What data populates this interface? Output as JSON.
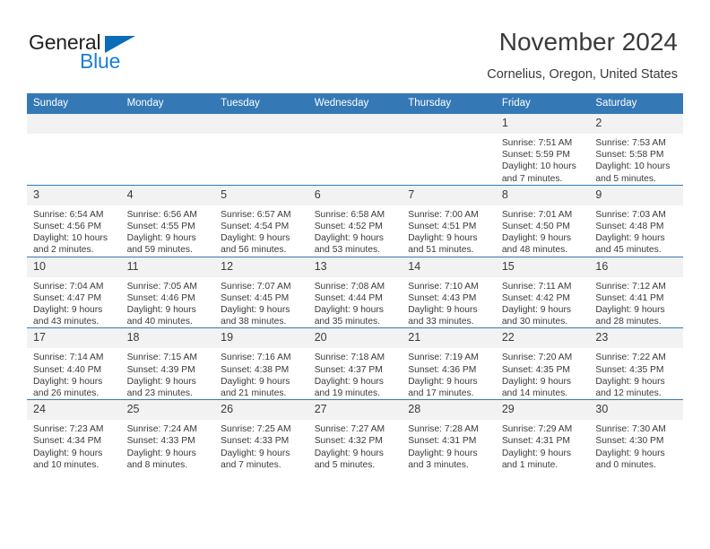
{
  "logo": {
    "word_one": "General",
    "word_two": "Blue",
    "triangle_icon": "triangle-icon",
    "color_dark": "#231f20",
    "color_blue": "#1b7fd4"
  },
  "header": {
    "title": "November 2024",
    "subtitle": "Cornelius, Oregon, United States",
    "accent_color": "#3479b5"
  },
  "calendar": {
    "weekday_headers": [
      "Sunday",
      "Monday",
      "Tuesday",
      "Wednesday",
      "Thursday",
      "Friday",
      "Saturday"
    ],
    "weeks": [
      [
        {
          "day": "",
          "sunrise": "",
          "sunset": "",
          "daylight_a": "",
          "daylight_b": ""
        },
        {
          "day": "",
          "sunrise": "",
          "sunset": "",
          "daylight_a": "",
          "daylight_b": ""
        },
        {
          "day": "",
          "sunrise": "",
          "sunset": "",
          "daylight_a": "",
          "daylight_b": ""
        },
        {
          "day": "",
          "sunrise": "",
          "sunset": "",
          "daylight_a": "",
          "daylight_b": ""
        },
        {
          "day": "",
          "sunrise": "",
          "sunset": "",
          "daylight_a": "",
          "daylight_b": ""
        },
        {
          "day": "1",
          "sunrise": "Sunrise: 7:51 AM",
          "sunset": "Sunset: 5:59 PM",
          "daylight_a": "Daylight: 10 hours",
          "daylight_b": "and 7 minutes."
        },
        {
          "day": "2",
          "sunrise": "Sunrise: 7:53 AM",
          "sunset": "Sunset: 5:58 PM",
          "daylight_a": "Daylight: 10 hours",
          "daylight_b": "and 5 minutes."
        }
      ],
      [
        {
          "day": "3",
          "sunrise": "Sunrise: 6:54 AM",
          "sunset": "Sunset: 4:56 PM",
          "daylight_a": "Daylight: 10 hours",
          "daylight_b": "and 2 minutes."
        },
        {
          "day": "4",
          "sunrise": "Sunrise: 6:56 AM",
          "sunset": "Sunset: 4:55 PM",
          "daylight_a": "Daylight: 9 hours",
          "daylight_b": "and 59 minutes."
        },
        {
          "day": "5",
          "sunrise": "Sunrise: 6:57 AM",
          "sunset": "Sunset: 4:54 PM",
          "daylight_a": "Daylight: 9 hours",
          "daylight_b": "and 56 minutes."
        },
        {
          "day": "6",
          "sunrise": "Sunrise: 6:58 AM",
          "sunset": "Sunset: 4:52 PM",
          "daylight_a": "Daylight: 9 hours",
          "daylight_b": "and 53 minutes."
        },
        {
          "day": "7",
          "sunrise": "Sunrise: 7:00 AM",
          "sunset": "Sunset: 4:51 PM",
          "daylight_a": "Daylight: 9 hours",
          "daylight_b": "and 51 minutes."
        },
        {
          "day": "8",
          "sunrise": "Sunrise: 7:01 AM",
          "sunset": "Sunset: 4:50 PM",
          "daylight_a": "Daylight: 9 hours",
          "daylight_b": "and 48 minutes."
        },
        {
          "day": "9",
          "sunrise": "Sunrise: 7:03 AM",
          "sunset": "Sunset: 4:48 PM",
          "daylight_a": "Daylight: 9 hours",
          "daylight_b": "and 45 minutes."
        }
      ],
      [
        {
          "day": "10",
          "sunrise": "Sunrise: 7:04 AM",
          "sunset": "Sunset: 4:47 PM",
          "daylight_a": "Daylight: 9 hours",
          "daylight_b": "and 43 minutes."
        },
        {
          "day": "11",
          "sunrise": "Sunrise: 7:05 AM",
          "sunset": "Sunset: 4:46 PM",
          "daylight_a": "Daylight: 9 hours",
          "daylight_b": "and 40 minutes."
        },
        {
          "day": "12",
          "sunrise": "Sunrise: 7:07 AM",
          "sunset": "Sunset: 4:45 PM",
          "daylight_a": "Daylight: 9 hours",
          "daylight_b": "and 38 minutes."
        },
        {
          "day": "13",
          "sunrise": "Sunrise: 7:08 AM",
          "sunset": "Sunset: 4:44 PM",
          "daylight_a": "Daylight: 9 hours",
          "daylight_b": "and 35 minutes."
        },
        {
          "day": "14",
          "sunrise": "Sunrise: 7:10 AM",
          "sunset": "Sunset: 4:43 PM",
          "daylight_a": "Daylight: 9 hours",
          "daylight_b": "and 33 minutes."
        },
        {
          "day": "15",
          "sunrise": "Sunrise: 7:11 AM",
          "sunset": "Sunset: 4:42 PM",
          "daylight_a": "Daylight: 9 hours",
          "daylight_b": "and 30 minutes."
        },
        {
          "day": "16",
          "sunrise": "Sunrise: 7:12 AM",
          "sunset": "Sunset: 4:41 PM",
          "daylight_a": "Daylight: 9 hours",
          "daylight_b": "and 28 minutes."
        }
      ],
      [
        {
          "day": "17",
          "sunrise": "Sunrise: 7:14 AM",
          "sunset": "Sunset: 4:40 PM",
          "daylight_a": "Daylight: 9 hours",
          "daylight_b": "and 26 minutes."
        },
        {
          "day": "18",
          "sunrise": "Sunrise: 7:15 AM",
          "sunset": "Sunset: 4:39 PM",
          "daylight_a": "Daylight: 9 hours",
          "daylight_b": "and 23 minutes."
        },
        {
          "day": "19",
          "sunrise": "Sunrise: 7:16 AM",
          "sunset": "Sunset: 4:38 PM",
          "daylight_a": "Daylight: 9 hours",
          "daylight_b": "and 21 minutes."
        },
        {
          "day": "20",
          "sunrise": "Sunrise: 7:18 AM",
          "sunset": "Sunset: 4:37 PM",
          "daylight_a": "Daylight: 9 hours",
          "daylight_b": "and 19 minutes."
        },
        {
          "day": "21",
          "sunrise": "Sunrise: 7:19 AM",
          "sunset": "Sunset: 4:36 PM",
          "daylight_a": "Daylight: 9 hours",
          "daylight_b": "and 17 minutes."
        },
        {
          "day": "22",
          "sunrise": "Sunrise: 7:20 AM",
          "sunset": "Sunset: 4:35 PM",
          "daylight_a": "Daylight: 9 hours",
          "daylight_b": "and 14 minutes."
        },
        {
          "day": "23",
          "sunrise": "Sunrise: 7:22 AM",
          "sunset": "Sunset: 4:35 PM",
          "daylight_a": "Daylight: 9 hours",
          "daylight_b": "and 12 minutes."
        }
      ],
      [
        {
          "day": "24",
          "sunrise": "Sunrise: 7:23 AM",
          "sunset": "Sunset: 4:34 PM",
          "daylight_a": "Daylight: 9 hours",
          "daylight_b": "and 10 minutes."
        },
        {
          "day": "25",
          "sunrise": "Sunrise: 7:24 AM",
          "sunset": "Sunset: 4:33 PM",
          "daylight_a": "Daylight: 9 hours",
          "daylight_b": "and 8 minutes."
        },
        {
          "day": "26",
          "sunrise": "Sunrise: 7:25 AM",
          "sunset": "Sunset: 4:33 PM",
          "daylight_a": "Daylight: 9 hours",
          "daylight_b": "and 7 minutes."
        },
        {
          "day": "27",
          "sunrise": "Sunrise: 7:27 AM",
          "sunset": "Sunset: 4:32 PM",
          "daylight_a": "Daylight: 9 hours",
          "daylight_b": "and 5 minutes."
        },
        {
          "day": "28",
          "sunrise": "Sunrise: 7:28 AM",
          "sunset": "Sunset: 4:31 PM",
          "daylight_a": "Daylight: 9 hours",
          "daylight_b": "and 3 minutes."
        },
        {
          "day": "29",
          "sunrise": "Sunrise: 7:29 AM",
          "sunset": "Sunset: 4:31 PM",
          "daylight_a": "Daylight: 9 hours",
          "daylight_b": "and 1 minute."
        },
        {
          "day": "30",
          "sunrise": "Sunrise: 7:30 AM",
          "sunset": "Sunset: 4:30 PM",
          "daylight_a": "Daylight: 9 hours",
          "daylight_b": "and 0 minutes."
        }
      ]
    ]
  }
}
